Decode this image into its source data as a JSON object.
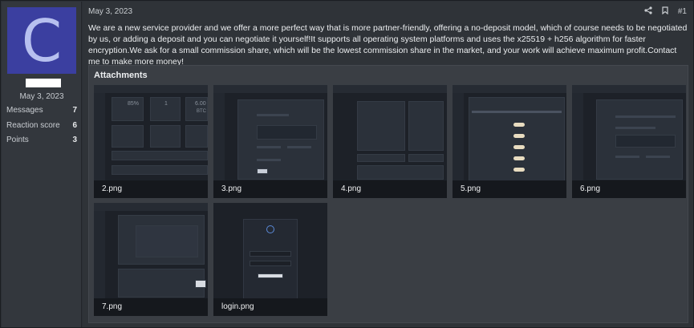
{
  "user": {
    "avatar_letter": "C",
    "joined": "May 3, 2023",
    "stats": [
      {
        "label": "Messages",
        "value": "7"
      },
      {
        "label": "Reaction score",
        "value": "6"
      },
      {
        "label": "Points",
        "value": "3"
      }
    ]
  },
  "post": {
    "date": "May 3, 2023",
    "number": "#1",
    "text": "We are a new service provider and we offer a more perfect way that is more partner-friendly, offering a no-deposit model, which of course needs to be negotiated by us, or adding a deposit and you can negotiate it yourself!It supports all operating system platforms and uses the x25519 + h256 algorithm for faster encryption.We ask for a small commission share, which will be the lowest commission share in the market, and your work will achieve maximum profit.Contact me to make more money!"
  },
  "attachments": {
    "title": "Attachments",
    "files": [
      "2.png",
      "3.png",
      "4.png",
      "5.png",
      "6.png",
      "7.png",
      "login.png"
    ]
  },
  "icons": {
    "share": "share-icon",
    "bookmark": "bookmark-icon"
  },
  "colors": {
    "avatar_bg": "#3b3fa0",
    "avatar_letter": "#b7c0ef",
    "background": "#2f3338"
  }
}
